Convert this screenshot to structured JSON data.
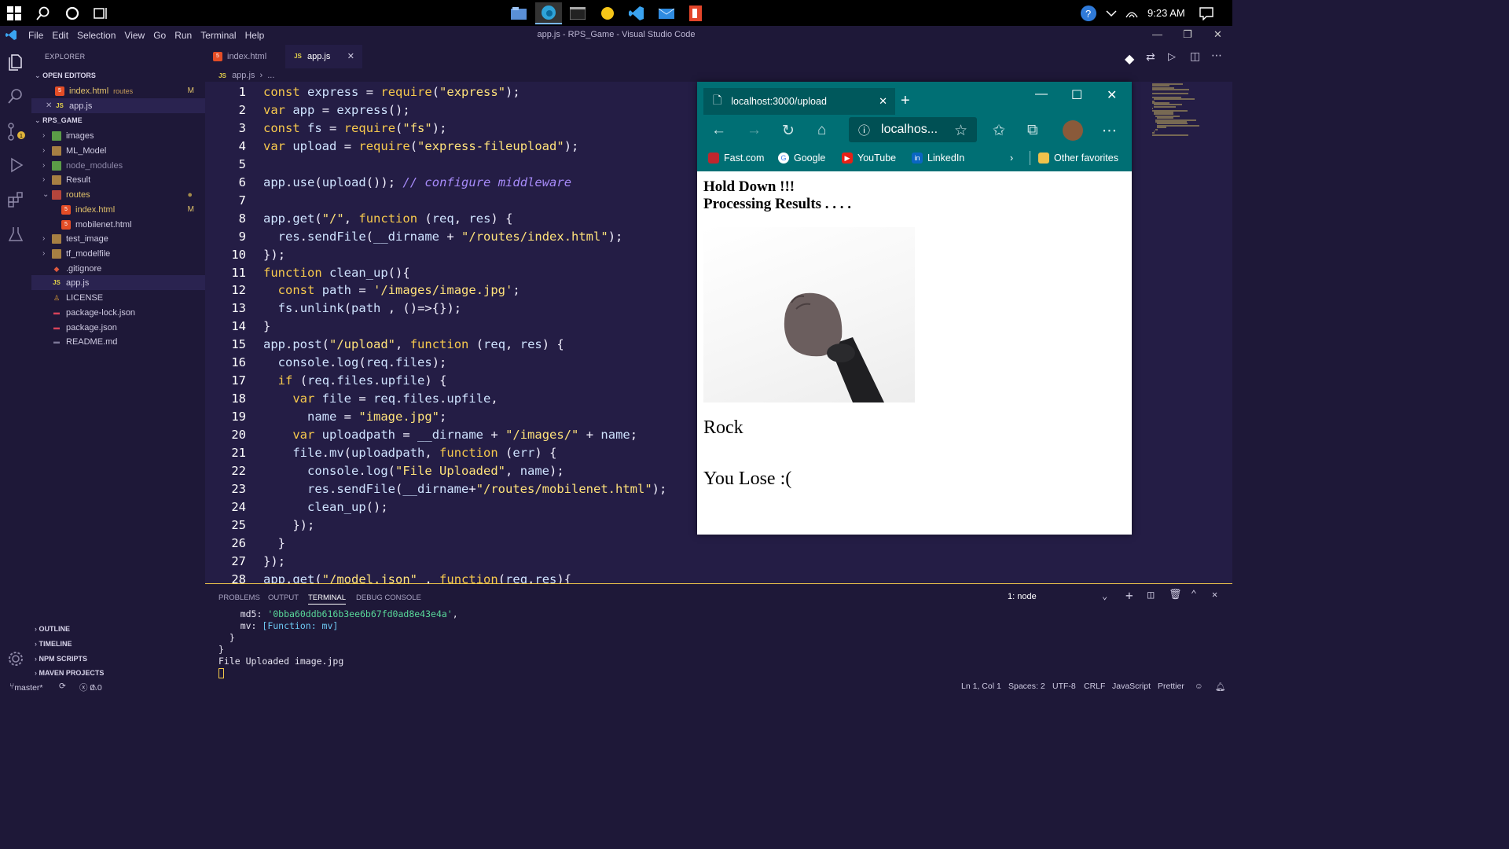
{
  "taskbar": {
    "time": "9:23 AM"
  },
  "titlebar": {
    "menu": [
      "File",
      "Edit",
      "Selection",
      "View",
      "Go",
      "Run",
      "Terminal",
      "Help"
    ],
    "title": "app.js - RPS_Game - Visual Studio Code"
  },
  "sidebar": {
    "header": "EXPLORER",
    "open_editors_label": "OPEN EDITORS",
    "open_editors": [
      {
        "name": "index.html",
        "tag": "routes",
        "badge": "M"
      },
      {
        "name": "app.js"
      }
    ],
    "project_label": "RPS_GAME",
    "tree": [
      {
        "name": "images"
      },
      {
        "name": "ML_Model"
      },
      {
        "name": "node_modules"
      },
      {
        "name": "Result"
      },
      {
        "name": "routes"
      },
      {
        "name": "index.html",
        "badge": "M"
      },
      {
        "name": "mobilenet.html"
      },
      {
        "name": "test_image"
      },
      {
        "name": "tf_modelfile"
      },
      {
        "name": ".gitignore"
      },
      {
        "name": "app.js"
      },
      {
        "name": "LICENSE"
      },
      {
        "name": "package-lock.json"
      },
      {
        "name": "package.json"
      },
      {
        "name": "README.md"
      }
    ],
    "bottom_sections": [
      "OUTLINE",
      "TIMELINE",
      "NPM SCRIPTS",
      "MAVEN PROJECTS"
    ]
  },
  "editor": {
    "tabs": [
      {
        "label": "index.html"
      },
      {
        "label": "app.js",
        "active": true
      }
    ],
    "breadcrumb": {
      "file": "app.js",
      "rest": "..."
    },
    "lines": [
      "const express = require(\"express\");",
      "var app = express();",
      "const fs = require(\"fs\");",
      "var upload = require(\"express-fileupload\");",
      "",
      "app.use(upload()); // configure middleware",
      "",
      "app.get(\"/\", function (req, res) {",
      "  res.sendFile(__dirname + \"/routes/index.html\");",
      "});",
      "function clean_up(){",
      "  const path = '/images/image.jpg';",
      "  fs.unlink(path , ()=>{});",
      "}",
      "app.post(\"/upload\", function (req, res) {",
      "  console.log(req.files);",
      "  if (req.files.upfile) {",
      "    var file = req.files.upfile,",
      "      name = \"image.jpg\";",
      "    var uploadpath = __dirname + \"/images/\" + name;",
      "    file.mv(uploadpath, function (err) {",
      "      console.log(\"File Uploaded\", name);",
      "      res.sendFile(__dirname+\"/routes/mobilenet.html\");",
      "      clean_up();",
      "    });",
      "  }",
      "});",
      "app.get(\"/model.json\" , function(req,res){"
    ]
  },
  "panel": {
    "tabs": [
      "PROBLEMS",
      "OUTPUT",
      "TERMINAL",
      "DEBUG CONSOLE"
    ],
    "active_tab": "TERMINAL",
    "terminal_select": "1: node",
    "terminal_lines": [
      {
        "key": "    md5: ",
        "value": "'0bba60ddb616b3ee6b67fd0ad8e43e4a'",
        "suffix": ","
      },
      {
        "key": "    mv: ",
        "value": "[Function: mv]",
        "suffix": ""
      },
      {
        "key": "  }",
        "value": "",
        "suffix": ""
      },
      {
        "key": "}",
        "value": "",
        "suffix": ""
      },
      {
        "key": "File Uploaded image.jpg",
        "value": "",
        "suffix": ""
      }
    ]
  },
  "statusbar": {
    "branch": "master*",
    "errors": "0",
    "warnings": "0",
    "position": "Ln 1, Col 1",
    "spaces": "Spaces: 2",
    "encoding": "UTF-8",
    "eol": "CRLF",
    "language": "JavaScript",
    "formatter": "Prettier"
  },
  "browser": {
    "tab_title": "localhost:3000/upload",
    "address": "localhos...",
    "favorites": [
      "Fast.com",
      "Google",
      "YouTube",
      "LinkedIn"
    ],
    "other_favorites": "Other favorites",
    "page": {
      "heading_1": "Hold Down !!!",
      "heading_2": "Processing Results . . . .",
      "prediction": "Rock",
      "result": "You Lose :("
    }
  },
  "colors": {
    "editor_bg": "#241d45",
    "sidebar_bg": "#1e1838",
    "accent": "#f3c94a",
    "browser_chrome": "#006f74"
  }
}
